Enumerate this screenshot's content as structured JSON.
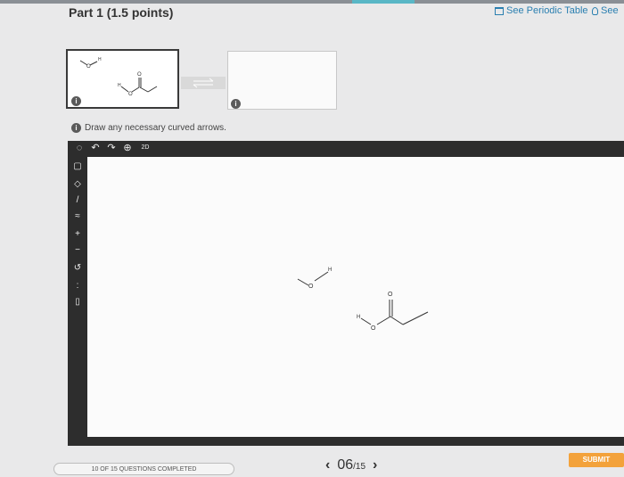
{
  "header": {
    "part_title": "Part 1  (1.5 points)",
    "periodic_link": "See Periodic Table",
    "hint_link": "See"
  },
  "reaction": {
    "left_info_badge": "i",
    "right_info_badge": "i",
    "molecule_labels": {
      "hydroxide_h": "H",
      "hydroxide_o": "O",
      "ester_o_carbonyl": "O",
      "ester_o": "O",
      "ester_h": "H"
    }
  },
  "instruction": {
    "badge": "i",
    "text": "Draw any necessary curved arrows."
  },
  "toolbar": {
    "tools": [
      "select",
      "undo",
      "redo",
      "zoom",
      "2D"
    ],
    "twod_label": "2D"
  },
  "sidebar_tools": [
    "select",
    "eraser",
    "bond",
    "ring",
    "plus",
    "minus",
    "arrow",
    "lone-pair",
    "rectangle"
  ],
  "canvas": {
    "molecules": {
      "hydroxide": {
        "h": "H",
        "o": "O"
      },
      "acid": {
        "h": "H",
        "o1": "O",
        "o2": "O"
      }
    }
  },
  "footer": {
    "progress": "10 OF 15 QUESTIONS COMPLETED",
    "page_current": "06",
    "page_total": "15",
    "page_separator": "/",
    "submit": "SUBMIT"
  }
}
